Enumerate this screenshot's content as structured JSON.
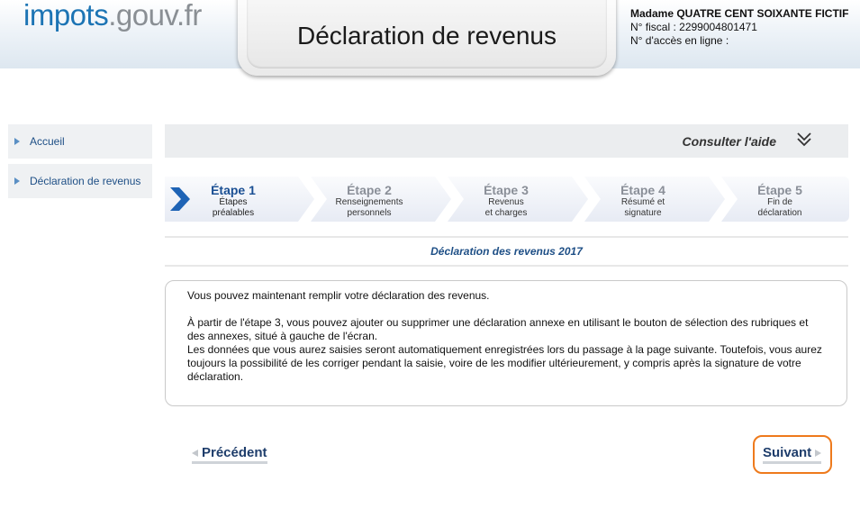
{
  "header": {
    "logo_part1": "impots",
    "logo_part2": ".gouv.fr",
    "title": "Déclaration de revenus",
    "user_name": "Madame QUATRE CENT SOIXANTE FICTIF",
    "fiscal_number": "N° fiscal : 2299004801471",
    "online_access": "N° d'accès en ligne :"
  },
  "sidebar": {
    "items": [
      {
        "label": "Accueil"
      },
      {
        "label": "Déclaration de revenus"
      }
    ]
  },
  "help": {
    "label": "Consulter l'aide"
  },
  "steps": [
    {
      "title": "Étape 1",
      "line1": "Étapes",
      "line2": "préalables",
      "active": true
    },
    {
      "title": "Étape 2",
      "line1": "Renseignements",
      "line2": "personnels",
      "active": false
    },
    {
      "title": "Étape 3",
      "line1": "Revenus",
      "line2": "et charges",
      "active": false
    },
    {
      "title": "Étape 4",
      "line1": "Résumé et",
      "line2": "signature",
      "active": false
    },
    {
      "title": "Étape 5",
      "line1": "Fin de",
      "line2": "déclaration",
      "active": false
    }
  ],
  "subtitle": "Déclaration des revenus 2017",
  "content": {
    "p1": "Vous pouvez maintenant remplir votre déclaration des revenus.",
    "p2": "À partir de l'étape 3, vous pouvez ajouter ou supprimer une déclaration annexe en utilisant le bouton de sélection des rubriques et des annexes, situé à gauche de l'écran.",
    "p3": "Les données que vous aurez saisies seront automatiquement enregistrées lors du passage à la page suivante. Toutefois, vous aurez toujours la possibilité de les corriger pendant la saisie, voire de les modifier ultérieurement, y compris après la signature de votre déclaration."
  },
  "nav": {
    "previous_label": "Précédent",
    "next_label": "Suivant"
  },
  "colors": {
    "brand_blue": "#1c74b4",
    "link_blue": "#1e4f86",
    "highlight_orange": "#ee7a1c"
  }
}
